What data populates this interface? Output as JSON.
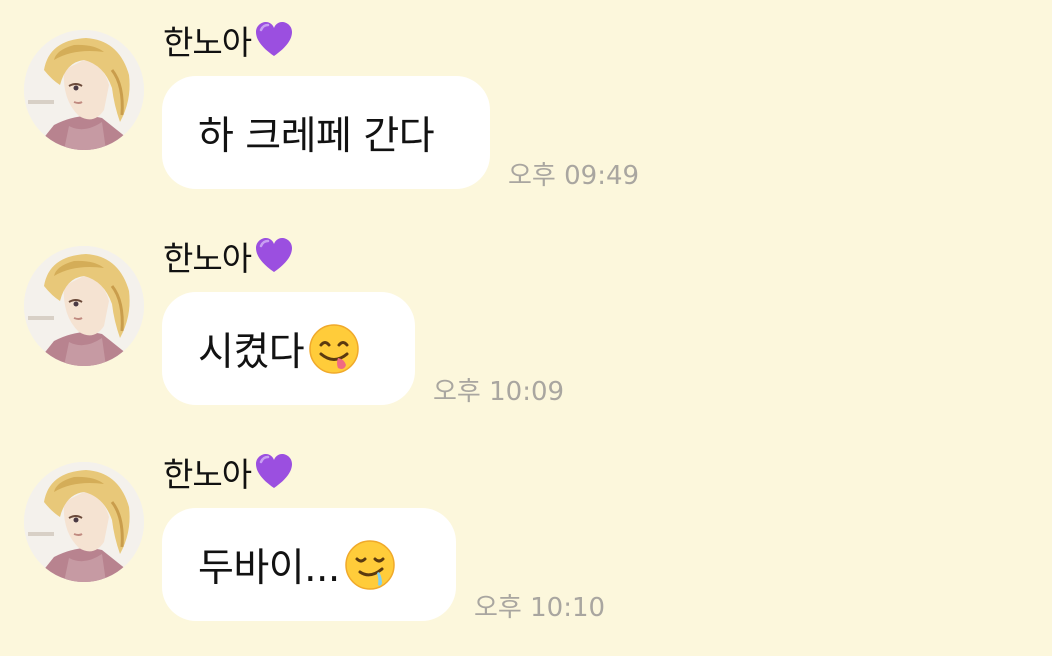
{
  "messages": [
    {
      "sender": "한노아",
      "text": "하 크레페 간다",
      "emoji": "",
      "time": "오후 09:49"
    },
    {
      "sender": "한노아",
      "text": "시켰다",
      "emoji": "yum-face-icon",
      "time": "오후 10:09"
    },
    {
      "sender": "한노아",
      "text": "두바이...",
      "emoji": "drooling-face-icon",
      "time": "오후 10:10"
    }
  ],
  "colors": {
    "background": "#fcf7dc",
    "bubble": "#ffffff",
    "timestamp": "#a9a6a0",
    "heart": "#9b4fe0"
  },
  "icons": {
    "sender_badge": "purple-heart-icon"
  }
}
